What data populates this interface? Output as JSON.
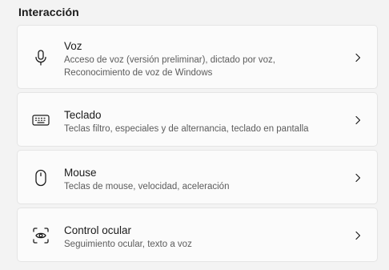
{
  "section": {
    "title": "Interacción"
  },
  "cards": [
    {
      "title": "Voz",
      "desc_line1": "Acceso de voz (versión preliminar), dictado por voz,",
      "desc_line2": "Reconocimiento de voz de Windows",
      "icon": "microphone-icon"
    },
    {
      "title": "Teclado",
      "desc_line1": "Teclas filtro, especiales y de alternancia, teclado en pantalla",
      "icon": "keyboard-icon"
    },
    {
      "title": "Mouse",
      "desc_line1": "Teclas de mouse, velocidad, aceleración",
      "icon": "mouse-icon"
    },
    {
      "title": "Control ocular",
      "desc_line1": "Seguimiento ocular, texto a voz",
      "icon": "eye-control-icon"
    }
  ]
}
